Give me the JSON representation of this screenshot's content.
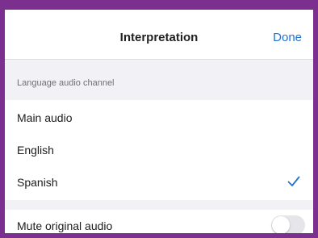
{
  "header": {
    "title": "Interpretation",
    "done_label": "Done"
  },
  "language_section": {
    "label": "Language audio channel",
    "options": [
      {
        "label": "Main audio",
        "selected": false
      },
      {
        "label": "English",
        "selected": false
      },
      {
        "label": "Spanish",
        "selected": true
      }
    ],
    "selected_icon": "checkmark-icon"
  },
  "mute": {
    "label": "Mute original audio",
    "enabled": false
  },
  "colors": {
    "frame": "#7b2f8e",
    "accent": "#1f72d6",
    "background": "#f2f2f6",
    "toggle_off": "#e6e6ea"
  }
}
